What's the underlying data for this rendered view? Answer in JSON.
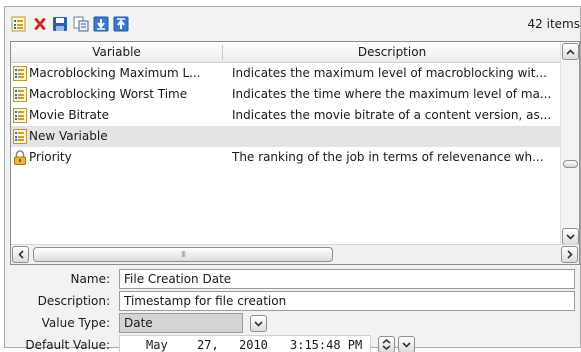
{
  "toolbar": {
    "buttons": [
      {
        "name": "new-variable-button",
        "icon": "variable-add-icon"
      },
      {
        "name": "delete-button",
        "icon": "red-x-icon"
      },
      {
        "name": "save-button",
        "icon": "floppy-disk-icon"
      },
      {
        "name": "copy-button",
        "icon": "copy-icon"
      },
      {
        "name": "import-button",
        "icon": "import-arrow-icon"
      },
      {
        "name": "export-button",
        "icon": "export-arrow-icon"
      }
    ],
    "item_count": "42 items"
  },
  "table": {
    "columns": [
      "Variable",
      "Description"
    ],
    "rows": [
      {
        "icon": "list-variable-icon",
        "name": "Macroblocking Maximum L...",
        "description": "Indicates the maximum level of macroblocking wit..."
      },
      {
        "icon": "list-variable-icon",
        "name": "Macroblocking Worst Time",
        "description": "Indicates the time where the maximum level of ma..."
      },
      {
        "icon": "list-variable-icon",
        "name": "Movie Bitrate",
        "description": "Indicates the movie bitrate of a content version, as..."
      },
      {
        "icon": "list-variable-icon",
        "name": "New Variable",
        "description": "",
        "selected": true
      },
      {
        "icon": "lock-icon",
        "name": "Priority",
        "description": "The ranking of the job in terms of relevenance wh..."
      }
    ],
    "hscroll_grip": "III"
  },
  "form": {
    "name_label": "Name:",
    "name_value": "File Creation Date",
    "description_label": "Description:",
    "description_value": "Timestamp for file creation",
    "value_type_label": "Value Type:",
    "value_type_value": "Date",
    "default_value_label": "Default Value:",
    "default_value": {
      "month": "May",
      "day": "27,",
      "year": "2010",
      "time": "3:15:48 PM"
    }
  },
  "colors": {
    "delete_red": "#d9262b",
    "icon_blue": "#2d6fc7",
    "selected_row": "#e4e4e4"
  }
}
